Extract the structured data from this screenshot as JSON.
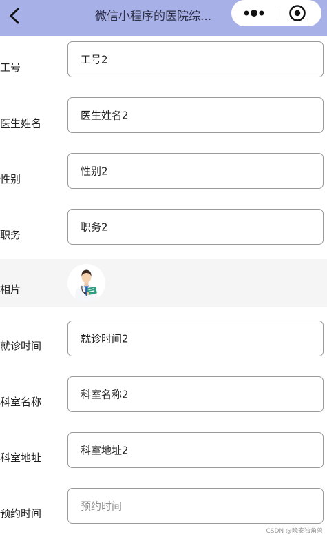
{
  "navbar": {
    "title": "微信小程序的医院综...",
    "back_icon": "chevron-left-icon",
    "more_icon": "more-dots-icon",
    "close_icon": "target-icon"
  },
  "form": [
    {
      "label": "工号",
      "value": "工号2",
      "placeholder": false
    },
    {
      "label": "医生姓名",
      "value": "医生姓名2",
      "placeholder": false
    },
    {
      "label": "性别",
      "value": "性别2",
      "placeholder": false
    },
    {
      "label": "职务",
      "value": "职务2",
      "placeholder": false
    },
    {
      "label": "相片",
      "type": "photo",
      "icon": "doctor-avatar-icon"
    },
    {
      "label": "就诊时间",
      "value": "就诊时间2",
      "placeholder": false
    },
    {
      "label": "科室名称",
      "value": "科室名称2",
      "placeholder": false
    },
    {
      "label": "科室地址",
      "value": "科室地址2",
      "placeholder": false
    },
    {
      "label": "预约时间",
      "value": "预约时间",
      "placeholder": true
    }
  ],
  "watermark": "CSDN @晚安独角兽"
}
